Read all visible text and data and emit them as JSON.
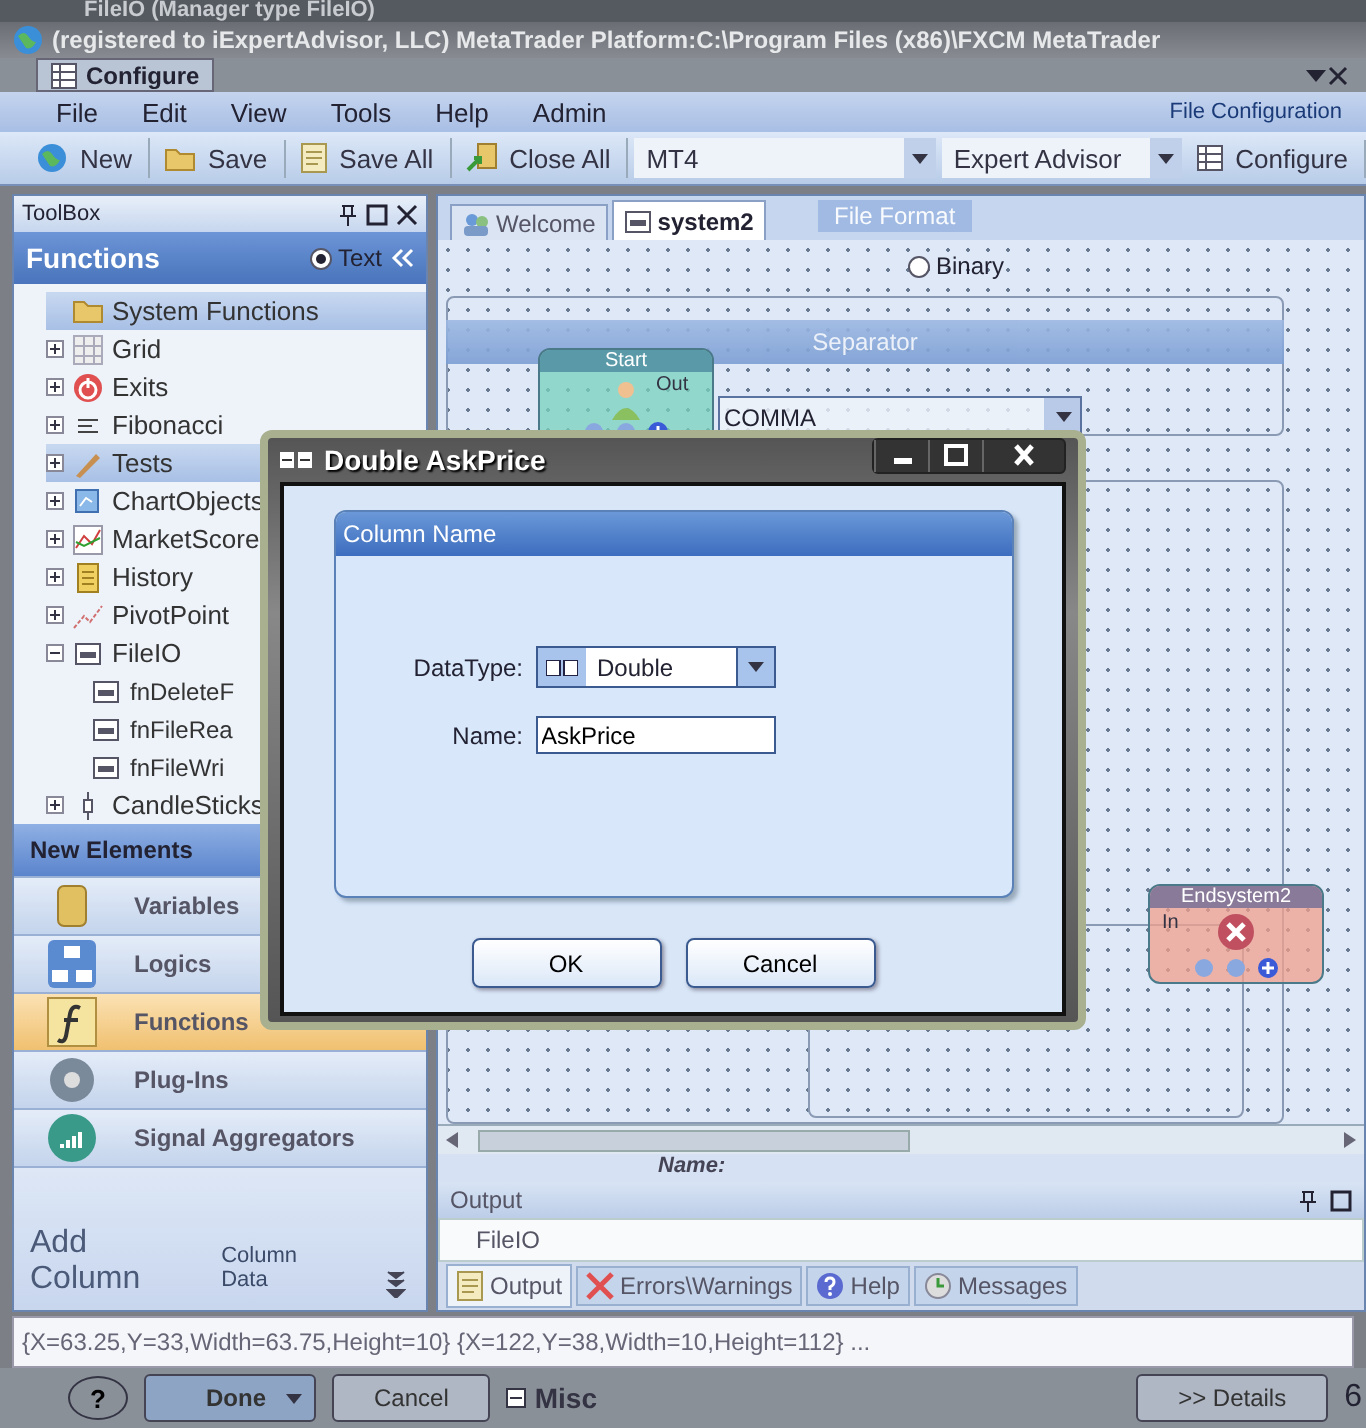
{
  "background_caption": "FileIO (Manager type FileIO)",
  "window": {
    "title": "(registered to iExpertAdvisor, LLC)  MetaTrader Platform:C:\\Program Files (x86)\\FXCM MetaTrader",
    "overlay_tab": "Configure"
  },
  "menu": {
    "items": [
      "File",
      "Edit",
      "View",
      "Tools",
      "Help",
      "Admin"
    ],
    "overlay_label": "File Configuration"
  },
  "toolbar": [
    {
      "kind": "button",
      "label": "New"
    },
    {
      "kind": "button",
      "label": "Save"
    },
    {
      "kind": "button",
      "label": "Save All"
    },
    {
      "kind": "button",
      "label": "Close All"
    },
    {
      "kind": "dropdown",
      "value": "MT4"
    },
    {
      "kind": "dropdown",
      "value": "Expert Advisor"
    },
    {
      "kind": "button",
      "label": "Configure"
    }
  ],
  "toolbox": {
    "title": "ToolBox",
    "section": "Functions",
    "overlay_radio": {
      "label": "Text",
      "selected": true
    },
    "tree": [
      {
        "label": "System Functions",
        "selected": true
      },
      {
        "label": "Grid",
        "expanded": false,
        "selected": false
      },
      {
        "label": "Exits",
        "expanded": false,
        "selected": false
      },
      {
        "label": "Fibonacci",
        "expanded": false,
        "selected": false
      },
      {
        "label": "Tests",
        "expanded": false,
        "selected": true
      },
      {
        "label": "ChartObjects",
        "expanded": false,
        "selected": false
      },
      {
        "label": "MarketScore",
        "expanded": false,
        "selected": false
      },
      {
        "label": "History",
        "expanded": false,
        "selected": false
      },
      {
        "label": "PivotPoint",
        "expanded": false,
        "selected": false
      },
      {
        "label": "FileIO",
        "expanded": true,
        "selected": false,
        "children": [
          {
            "label": "fnDeleteF"
          },
          {
            "label": "fnFileRea"
          },
          {
            "label": "fnFileWri"
          }
        ]
      },
      {
        "label": "CandleSticks",
        "expanded": false,
        "selected": false
      }
    ]
  },
  "navigation": {
    "header": "New Elements",
    "overlay_label": "Column Data",
    "overlay_caption": "Add Column",
    "items": [
      {
        "label": "Variables",
        "selected": false
      },
      {
        "label": "Logics",
        "selected": false
      },
      {
        "label": "Functions",
        "selected": true
      },
      {
        "label": "Plug-Ins",
        "selected": false
      },
      {
        "label": "Signal Aggregators",
        "selected": false
      }
    ]
  },
  "document": {
    "tabs": [
      {
        "label": "Welcome",
        "selected": false
      },
      {
        "label": "system2",
        "selected": true
      }
    ],
    "overlay_header": "File Format",
    "overlay_radio": {
      "label": "Binary",
      "selected": false
    },
    "separator_header": "Separator",
    "separator_value": "COMMA",
    "nodes": [
      {
        "kind": "start",
        "title": "Start",
        "port": "Out"
      },
      {
        "kind": "end",
        "title": "Endsystem2",
        "port": "In"
      }
    ],
    "name_label": "Name:"
  },
  "output": {
    "title": "Output",
    "source": "FileIO",
    "tabs": [
      {
        "label": "Output",
        "selected": true
      },
      {
        "label": "Errors\\Warnings",
        "selected": false
      },
      {
        "label": "Help",
        "selected": false
      },
      {
        "label": "Messages",
        "selected": false
      }
    ]
  },
  "status_bar": "{X=63.25,Y=33,Width=63.75,Height=10} {X=122,Y=38,Width=10,Height=112} ...",
  "footer": {
    "help": "?",
    "done": "Done",
    "cancel": "Cancel",
    "details": ">> Details",
    "section": "Misc",
    "edge_text": "6"
  },
  "dialog": {
    "title": "Double AskPrice",
    "group": "Column Name",
    "fields": [
      {
        "kind": "dropdown",
        "label": "DataType:",
        "value": "Double"
      },
      {
        "kind": "text",
        "label": "Name:",
        "value": "AskPrice"
      }
    ],
    "buttons": [
      "OK",
      "Cancel"
    ]
  }
}
